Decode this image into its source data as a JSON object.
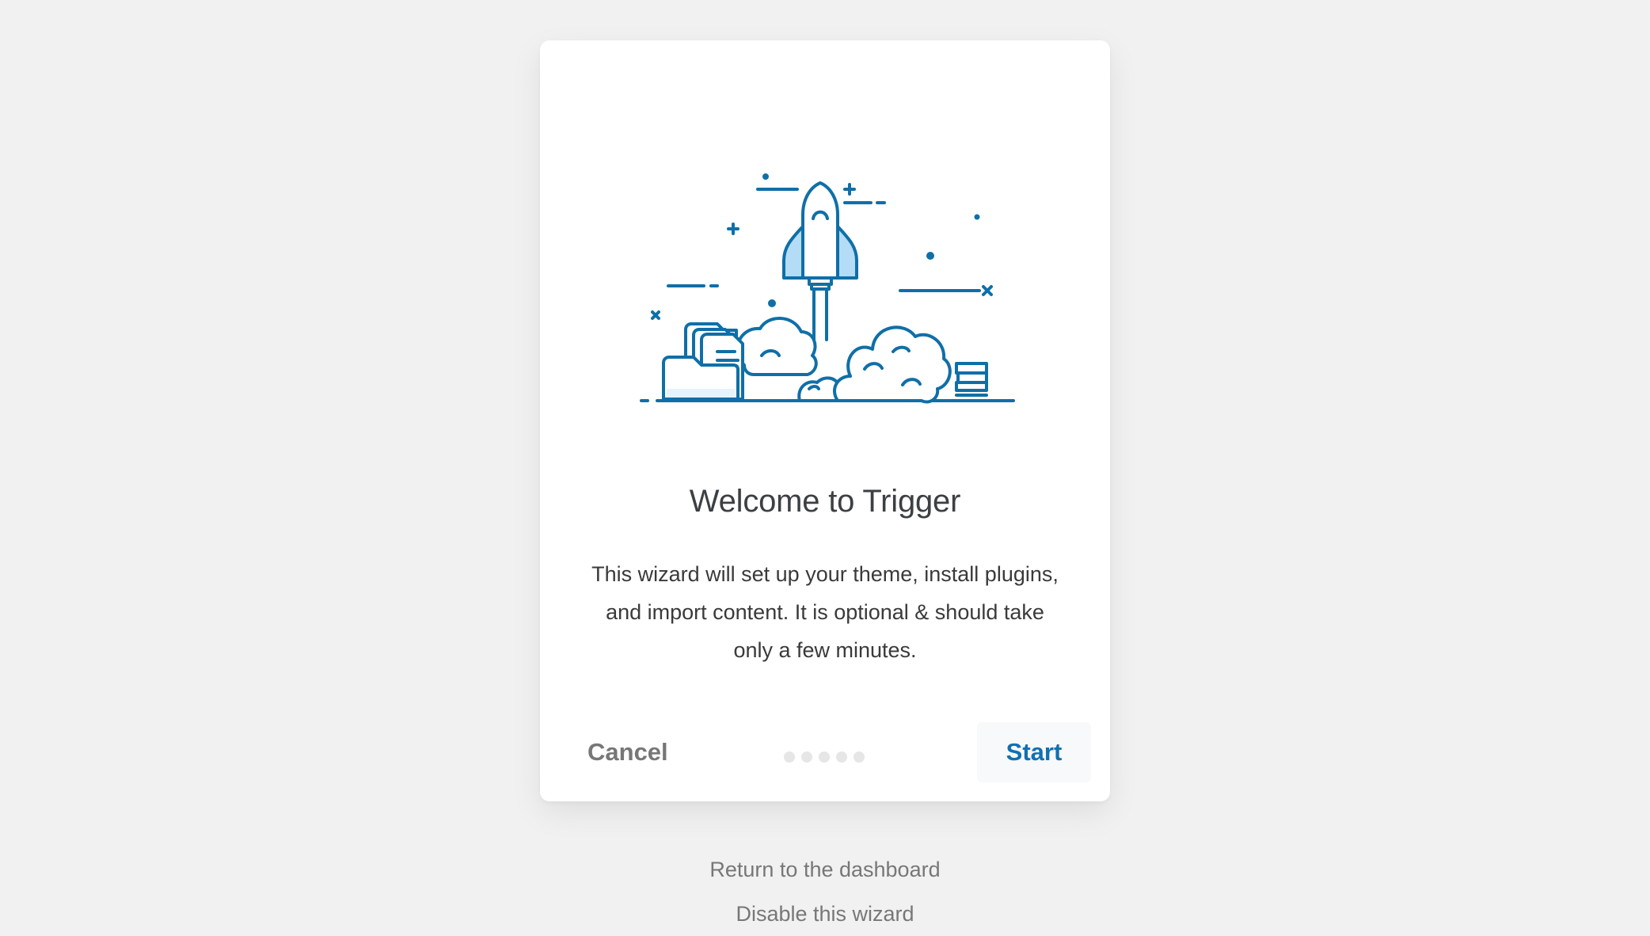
{
  "colors": {
    "page_bg": "#f1f1f1",
    "card_bg": "#ffffff",
    "accent": "#1270b0",
    "illustration_stroke": "#0f6fa8",
    "illustration_fill": "#b5dcf6",
    "muted_text": "#777777",
    "title_text": "#3c4043"
  },
  "illustration": {
    "icon": "rocket-launch-illustration"
  },
  "wizard": {
    "title": "Welcome to Trigger",
    "description": "This wizard will set up your theme, install plugins, and import content. It is optional & should take only a few minutes.",
    "cancel_label": "Cancel",
    "start_label": "Start",
    "step_current": 1,
    "step_total": 5
  },
  "links": {
    "dashboard": "Return to the dashboard",
    "disable": "Disable this wizard"
  }
}
